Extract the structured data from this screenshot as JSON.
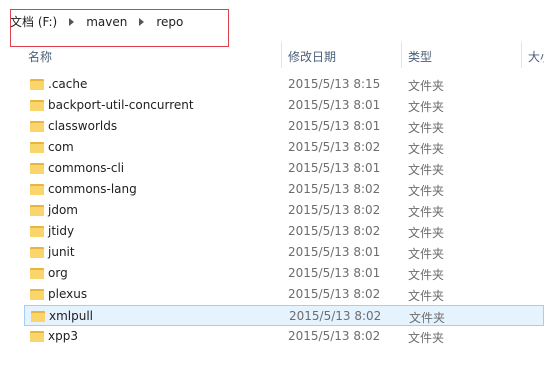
{
  "breadcrumb": [
    "文档 (F:)",
    "maven",
    "repo"
  ],
  "columns": {
    "name": "名称",
    "date": "修改日期",
    "type": "类型",
    "size": "大小"
  },
  "files": [
    {
      "name": ".cache",
      "date": "2015/5/13 8:15",
      "type": "文件夹",
      "selected": false
    },
    {
      "name": "backport-util-concurrent",
      "date": "2015/5/13 8:01",
      "type": "文件夹",
      "selected": false
    },
    {
      "name": "classworlds",
      "date": "2015/5/13 8:01",
      "type": "文件夹",
      "selected": false
    },
    {
      "name": "com",
      "date": "2015/5/13 8:02",
      "type": "文件夹",
      "selected": false
    },
    {
      "name": "commons-cli",
      "date": "2015/5/13 8:01",
      "type": "文件夹",
      "selected": false
    },
    {
      "name": "commons-lang",
      "date": "2015/5/13 8:02",
      "type": "文件夹",
      "selected": false
    },
    {
      "name": "jdom",
      "date": "2015/5/13 8:02",
      "type": "文件夹",
      "selected": false
    },
    {
      "name": "jtidy",
      "date": "2015/5/13 8:02",
      "type": "文件夹",
      "selected": false
    },
    {
      "name": "junit",
      "date": "2015/5/13 8:01",
      "type": "文件夹",
      "selected": false
    },
    {
      "name": "org",
      "date": "2015/5/13 8:01",
      "type": "文件夹",
      "selected": false
    },
    {
      "name": "plexus",
      "date": "2015/5/13 8:02",
      "type": "文件夹",
      "selected": false
    },
    {
      "name": "xmlpull",
      "date": "2015/5/13 8:02",
      "type": "文件夹",
      "selected": true
    },
    {
      "name": "xpp3",
      "date": "2015/5/13 8:02",
      "type": "文件夹",
      "selected": false
    }
  ]
}
